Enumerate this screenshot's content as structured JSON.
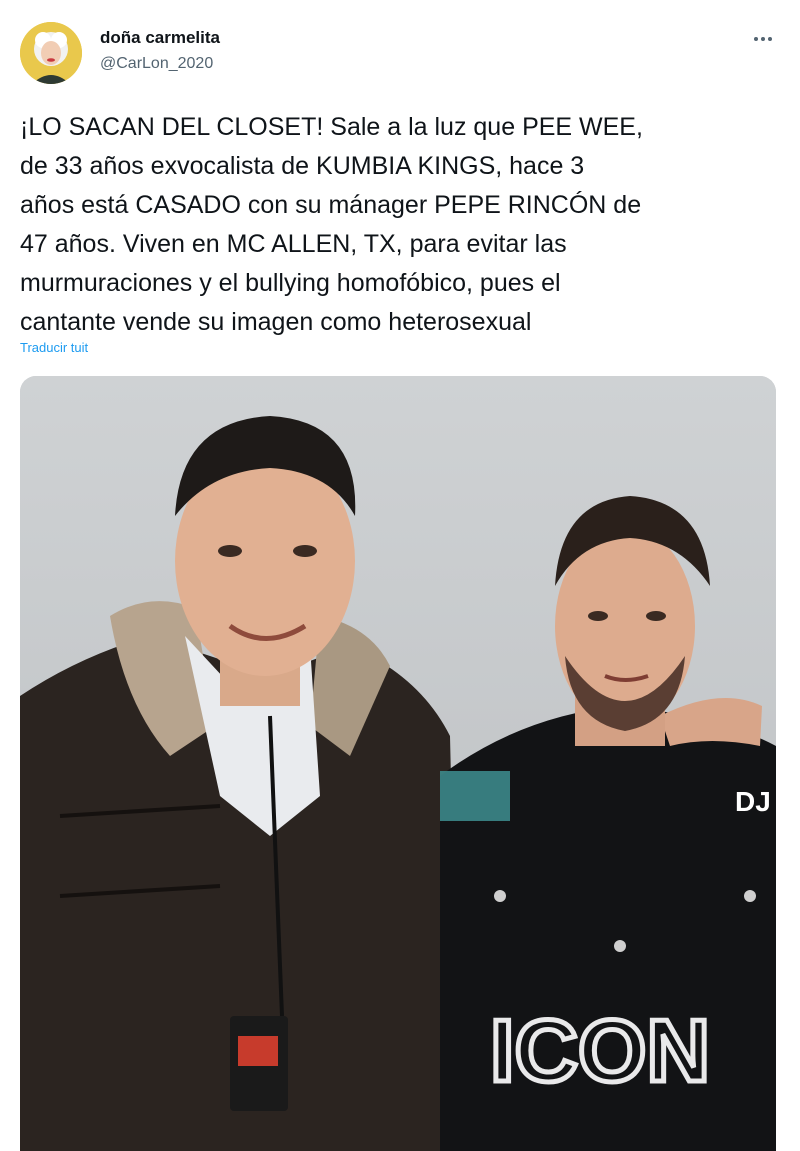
{
  "author": {
    "display_name": "doña carmelita",
    "handle": "@CarLon_2020",
    "avatar_icon": "profile-avatar"
  },
  "tweet": {
    "text_lines": [
      "¡LO SACAN DEL CLOSET! Sale a la luz que PEE WEE,",
      "de 33 años exvocalista de KUMBIA KINGS, hace 3",
      "años está CASADO con su mánager PEPE RINCÓN de",
      "47 años. Viven en MC ALLEN, TX, para evitar las",
      "murmuraciones y el bullying homofóbico, pues el",
      "cantante vende su imagen como heterosexual"
    ],
    "translate_label": "Traducir tuit"
  },
  "media": {
    "icon": "photo-two-men"
  },
  "colors": {
    "accent": "#1d9bf0",
    "text": "#0f1419",
    "muted": "#536471"
  }
}
